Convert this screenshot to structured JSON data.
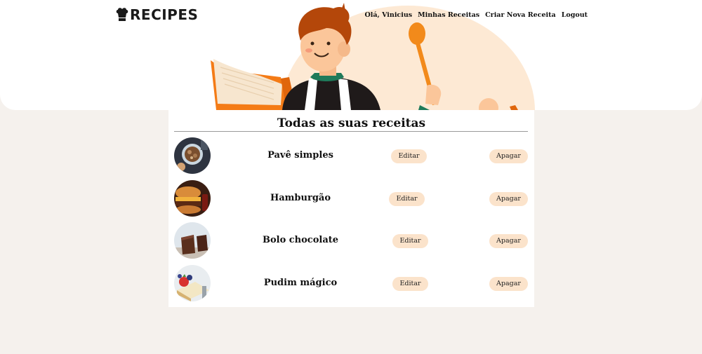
{
  "brand": {
    "name": "RECIPES",
    "icon": "chef-hat-icon"
  },
  "nav": {
    "greeting": "Olá, Vinicius",
    "my_recipes": "Minhas Receitas",
    "create_recipe": "Criar Nova Receita",
    "logout": "Logout"
  },
  "page": {
    "title": "Todas as suas receitas"
  },
  "recipes": [
    {
      "name": "Pavê simples",
      "edit_label": "Editar",
      "delete_label": "Apagar"
    },
    {
      "name": "Hamburgão",
      "edit_label": "Editar",
      "delete_label": "Apagar"
    },
    {
      "name": "Bolo chocolate",
      "edit_label": "Editar",
      "delete_label": "Apagar"
    },
    {
      "name": "Pudim mágico",
      "edit_label": "Editar",
      "delete_label": "Apagar"
    }
  ],
  "colors": {
    "background": "#f5f1ed",
    "hero_blob": "#fde9d4",
    "button_bg": "#fbe3cb",
    "accent_orange": "#f47b16"
  }
}
